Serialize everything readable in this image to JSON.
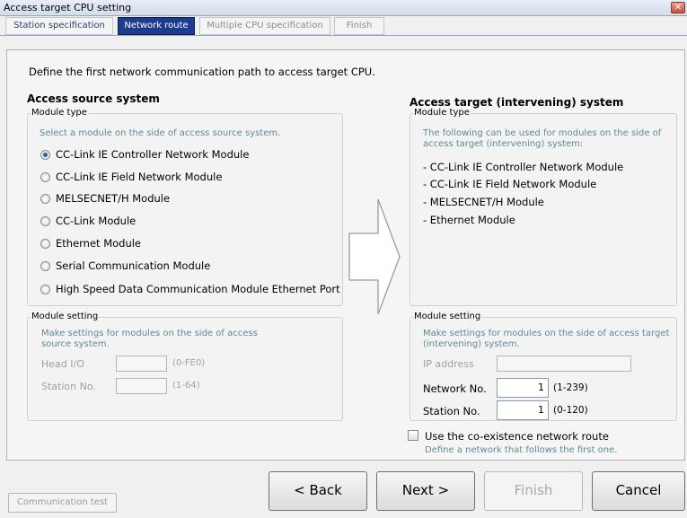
{
  "window": {
    "title": "Access target CPU setting",
    "close_glyph": "✕"
  },
  "tabs": [
    {
      "label": "Station specification",
      "state": "enabled"
    },
    {
      "label": "Network route",
      "state": "active"
    },
    {
      "label": "Multiple CPU specification",
      "state": "disabled"
    },
    {
      "label": "Finish",
      "state": "disabled"
    }
  ],
  "instruction": "Define the first network communication path to access target CPU.",
  "source": {
    "heading": "Access source system",
    "module_type_legend": "Module type",
    "module_type_hint": "Select a module on the side of access source system.",
    "options": [
      "CC-Link IE Controller Network Module",
      "CC-Link IE Field Network Module",
      "MELSECNET/H Module",
      "CC-Link Module",
      "Ethernet Module",
      "Serial Communication Module",
      "High Speed Data Communication Module Ethernet Port"
    ],
    "selected_option": "CC-Link IE Controller Network Module",
    "module_setting_legend": "Module setting",
    "module_setting_hint_1": "Make settings for modules on the side of access",
    "module_setting_hint_2": "source system.",
    "head_io_label": "Head I/O",
    "head_io_value": "",
    "head_io_range": "(0-FE0)",
    "station_label": "Station No.",
    "station_value": "",
    "station_range": "(1-64)"
  },
  "target": {
    "heading": "Access target (intervening) system",
    "module_type_legend": "Module type",
    "module_type_hint_1": "The following can be used for modules on the side of",
    "module_type_hint_2": "access target (intervening) system:",
    "list": [
      "- CC-Link IE Controller Network Module",
      "- CC-Link IE Field Network Module",
      "- MELSECNET/H Module",
      "- Ethernet Module"
    ],
    "module_setting_legend": "Module setting",
    "module_setting_hint_1": "Make settings for modules on the side of access target",
    "module_setting_hint_2": "(intervening) system.",
    "ip_label": "IP address",
    "ip_value": "",
    "network_label": "Network No.",
    "network_value": "1",
    "network_range": "(1-239)",
    "station_label": "Station No.",
    "station_value": "1",
    "station_range": "(0-120)"
  },
  "coexistence": {
    "label": "Use the co-existence network route",
    "hint": "Define a network that follows the first one.",
    "checked": false
  },
  "buttons": {
    "communication_test": "Communication test",
    "back": "< Back",
    "next": "Next >",
    "finish": "Finish",
    "cancel": "Cancel"
  },
  "icons": {
    "arrow": "right-arrow-icon"
  }
}
